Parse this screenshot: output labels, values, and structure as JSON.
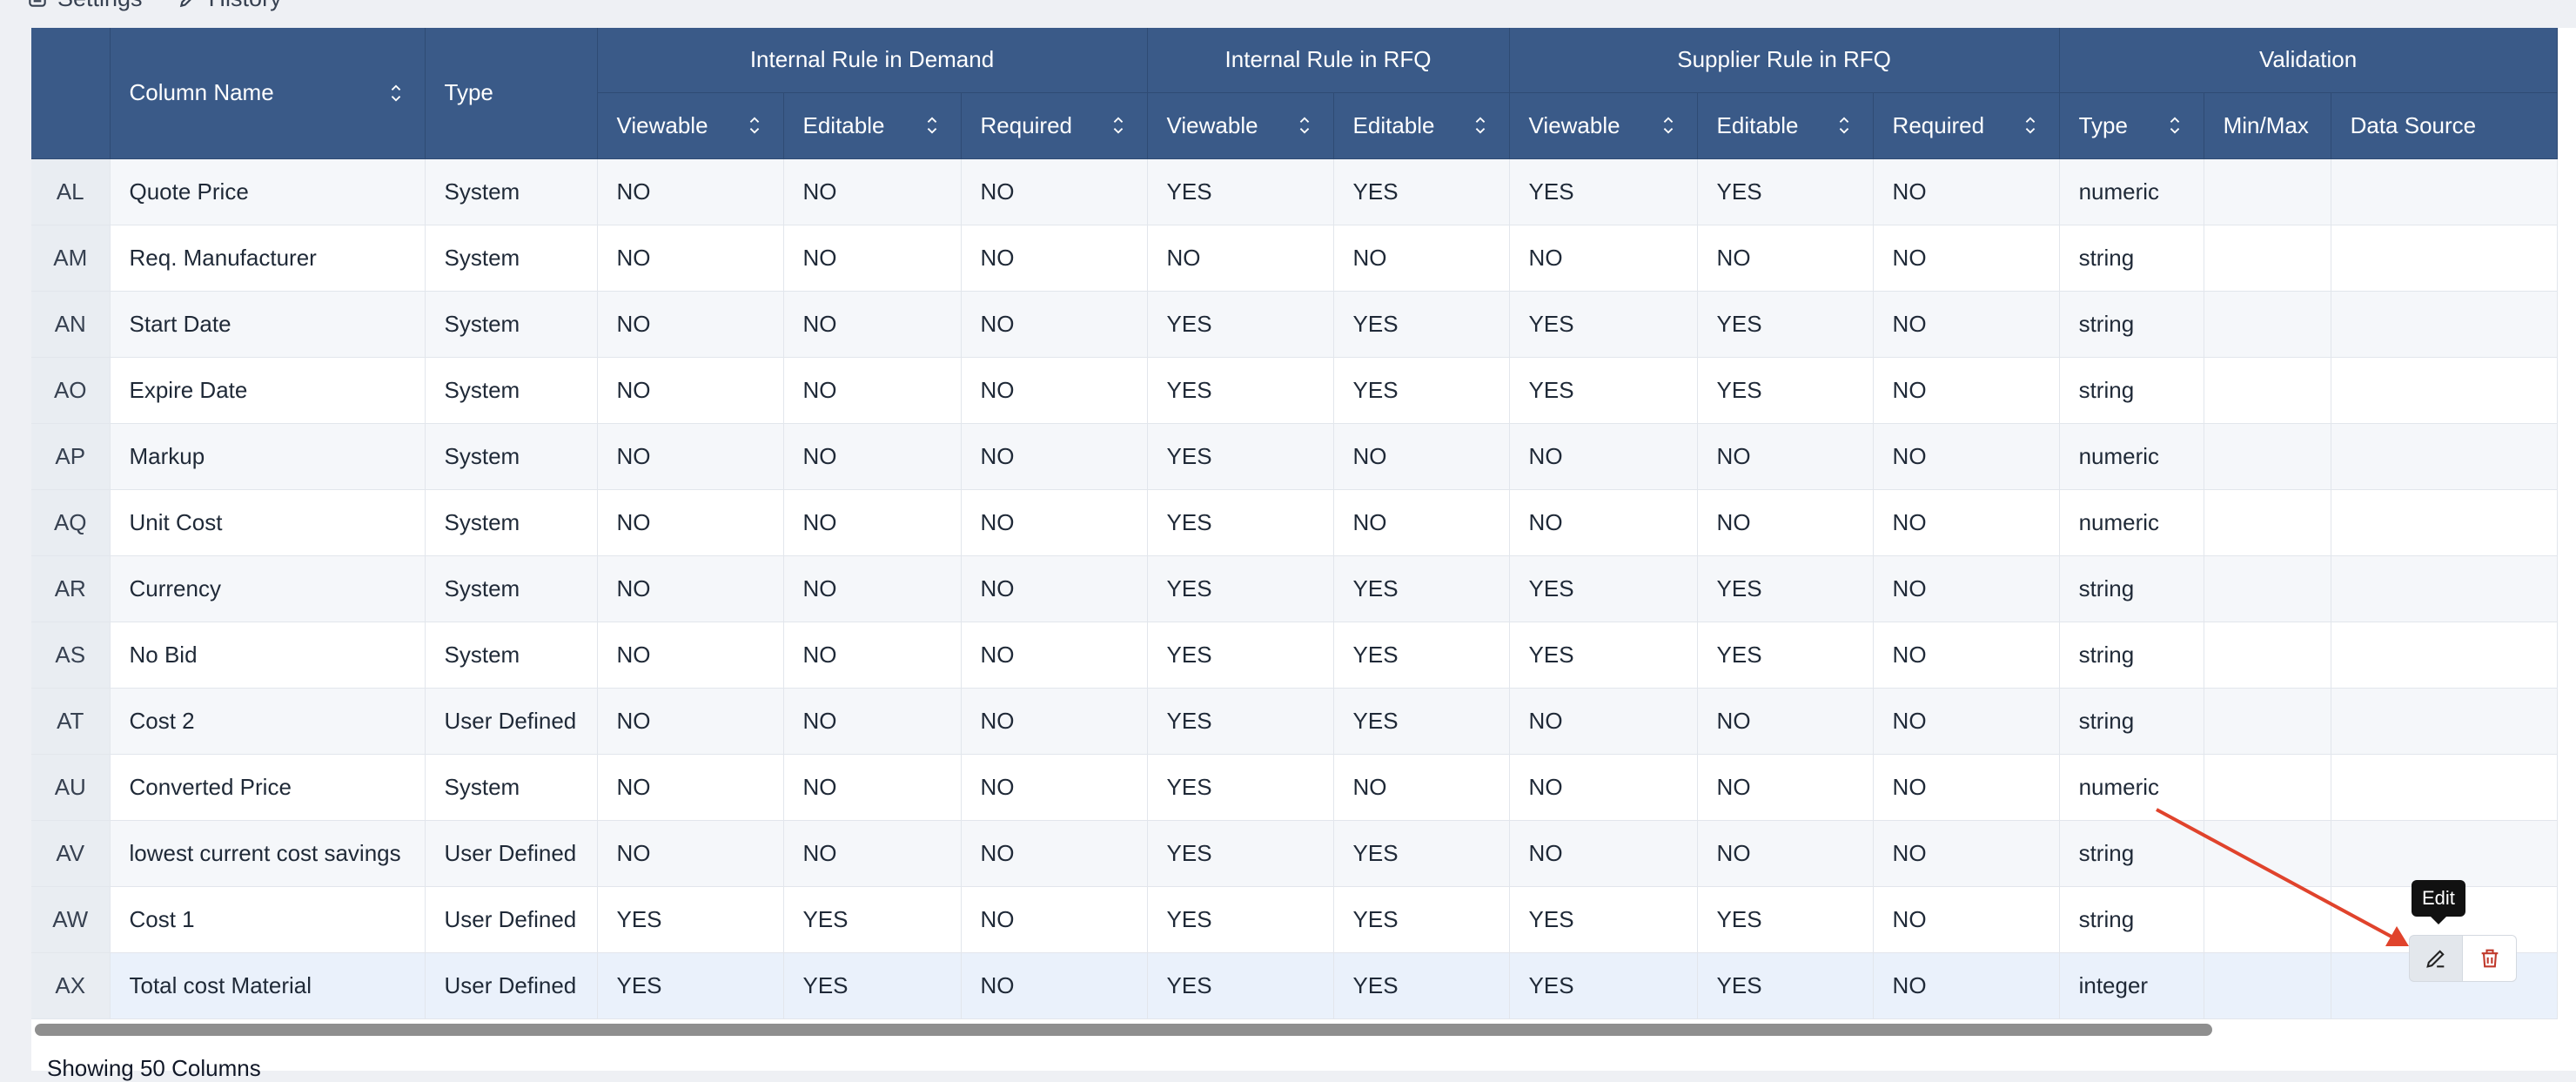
{
  "topnav": {
    "settings_label": "Settings",
    "history_label": "History"
  },
  "header": {
    "column_name": "Column Name",
    "type": "Type",
    "groups": [
      "Internal Rule in Demand",
      "Internal Rule in RFQ",
      "Supplier Rule in RFQ",
      "Validation"
    ],
    "sub": [
      "Viewable",
      "Editable",
      "Required",
      "Viewable",
      "Editable",
      "Viewable",
      "Editable",
      "Required",
      "Type",
      "Min/Max",
      "Data Source"
    ]
  },
  "rows": [
    {
      "id": "AL",
      "name": "Quote Price",
      "type": "System",
      "v": [
        "NO",
        "NO",
        "NO",
        "YES",
        "YES",
        "YES",
        "YES",
        "NO",
        "numeric",
        "",
        ""
      ]
    },
    {
      "id": "AM",
      "name": "Req. Manufacturer",
      "type": "System",
      "v": [
        "NO",
        "NO",
        "NO",
        "NO",
        "NO",
        "NO",
        "NO",
        "NO",
        "string",
        "",
        ""
      ]
    },
    {
      "id": "AN",
      "name": "Start Date",
      "type": "System",
      "v": [
        "NO",
        "NO",
        "NO",
        "YES",
        "YES",
        "YES",
        "YES",
        "NO",
        "string",
        "",
        ""
      ]
    },
    {
      "id": "AO",
      "name": "Expire Date",
      "type": "System",
      "v": [
        "NO",
        "NO",
        "NO",
        "YES",
        "YES",
        "YES",
        "YES",
        "NO",
        "string",
        "",
        ""
      ]
    },
    {
      "id": "AP",
      "name": "Markup",
      "type": "System",
      "v": [
        "NO",
        "NO",
        "NO",
        "YES",
        "NO",
        "NO",
        "NO",
        "NO",
        "numeric",
        "",
        ""
      ]
    },
    {
      "id": "AQ",
      "name": "Unit Cost",
      "type": "System",
      "v": [
        "NO",
        "NO",
        "NO",
        "YES",
        "NO",
        "NO",
        "NO",
        "NO",
        "numeric",
        "",
        ""
      ]
    },
    {
      "id": "AR",
      "name": "Currency",
      "type": "System",
      "v": [
        "NO",
        "NO",
        "NO",
        "YES",
        "YES",
        "YES",
        "YES",
        "NO",
        "string",
        "",
        ""
      ]
    },
    {
      "id": "AS",
      "name": "No Bid",
      "type": "System",
      "v": [
        "NO",
        "NO",
        "NO",
        "YES",
        "YES",
        "YES",
        "YES",
        "NO",
        "string",
        "",
        ""
      ]
    },
    {
      "id": "AT",
      "name": "Cost 2",
      "type": "User Defined",
      "v": [
        "NO",
        "NO",
        "NO",
        "YES",
        "YES",
        "NO",
        "NO",
        "NO",
        "string",
        "",
        ""
      ]
    },
    {
      "id": "AU",
      "name": "Converted Price",
      "type": "System",
      "v": [
        "NO",
        "NO",
        "NO",
        "YES",
        "NO",
        "NO",
        "NO",
        "NO",
        "numeric",
        "",
        ""
      ]
    },
    {
      "id": "AV",
      "name": "lowest current cost savings",
      "type": "User Defined",
      "v": [
        "NO",
        "NO",
        "NO",
        "YES",
        "YES",
        "NO",
        "NO",
        "NO",
        "string",
        "",
        ""
      ]
    },
    {
      "id": "AW",
      "name": "Cost 1",
      "type": "User Defined",
      "v": [
        "YES",
        "YES",
        "NO",
        "YES",
        "YES",
        "YES",
        "YES",
        "NO",
        "string",
        "",
        ""
      ]
    },
    {
      "id": "AX",
      "name": "Total cost Material",
      "type": "User Defined",
      "v": [
        "YES",
        "YES",
        "NO",
        "YES",
        "YES",
        "YES",
        "YES",
        "NO",
        "integer",
        "",
        ""
      ]
    }
  ],
  "tooltip": {
    "edit": "Edit"
  },
  "footer": {
    "showing": "Showing 50 Columns"
  },
  "colors": {
    "header_bg": "#3a5a88",
    "annotation_arrow": "#e0432c",
    "delete_icon": "#c0392b"
  }
}
